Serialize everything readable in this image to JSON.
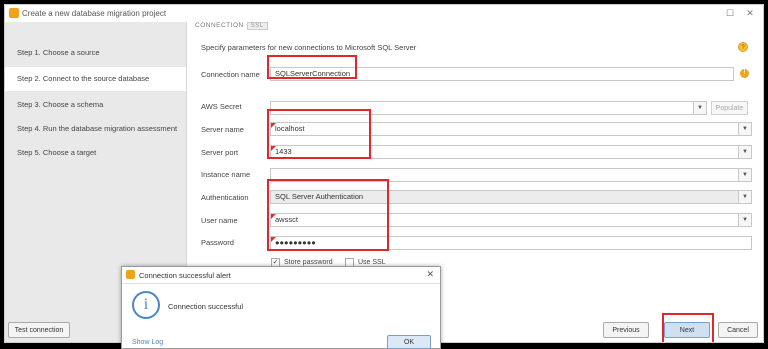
{
  "window": {
    "title": "Create a new database migration project",
    "minimize_glyph": "☐",
    "close_glyph": "✕"
  },
  "sidebar": {
    "steps": [
      {
        "label": "Step 1. Choose a source"
      },
      {
        "label": "Step 2. Connect to the source database"
      },
      {
        "label": "Step 3. Choose a schema"
      },
      {
        "label": "Step 4. Run the database migration assessment"
      },
      {
        "label": "Step 5. Choose a target"
      }
    ],
    "test_connection_label": "Test connection"
  },
  "form": {
    "section_tab": "CONNECTION",
    "section_tab_mini": "SSL",
    "description": "Specify parameters for new connections to Microsoft SQL Server",
    "connection_name": {
      "label": "Connection name",
      "value": "SQLServerConnection"
    },
    "aws_secret": {
      "label": "AWS Secret",
      "value": "",
      "populate_label": "Populate"
    },
    "server_name": {
      "label": "Server name",
      "value": "localhost"
    },
    "server_port": {
      "label": "Server port",
      "value": "1433"
    },
    "instance_name": {
      "label": "Instance name",
      "value": ""
    },
    "authentication": {
      "label": "Authentication",
      "value": "SQL Server Authentication"
    },
    "user_name": {
      "label": "User name",
      "value": "awssct"
    },
    "password": {
      "label": "Password",
      "value": "●●●●●●●●●"
    },
    "store_password": {
      "label": "Store password",
      "checked": true
    },
    "use_ssl": {
      "label": "Use SSL",
      "checked": false
    }
  },
  "footer": {
    "previous_label": "Previous",
    "next_label": "Next",
    "cancel_label": "Cancel"
  },
  "dialog": {
    "title": "Connection successful alert",
    "message": "Connection successful",
    "show_log_label": "Show Log",
    "ok_label": "OK",
    "close_glyph": "✕",
    "icon_glyph": "i"
  },
  "colors": {
    "accent_orange": "#f0a31a",
    "highlight_red": "#e0262e",
    "info_blue": "#4a86c8"
  },
  "icons": {
    "dropdown": "chevron-down-icon",
    "info": "info-icon",
    "help": "help-icon"
  }
}
